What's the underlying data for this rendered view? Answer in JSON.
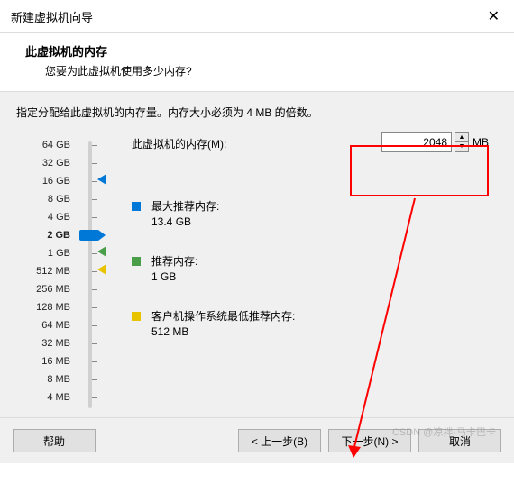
{
  "title": "新建虚拟机向导",
  "header": {
    "title": "此虚拟机的内存",
    "subtitle": "您要为此虚拟机使用多少内存?"
  },
  "instruction": "指定分配给此虚拟机的内存量。内存大小必须为 4 MB 的倍数。",
  "scale": [
    "64 GB",
    "32 GB",
    "16 GB",
    "8 GB",
    "4 GB",
    "2 GB",
    "1 GB",
    "512 MB",
    "256 MB",
    "128 MB",
    "64 MB",
    "32 MB",
    "16 MB",
    "8 MB",
    "4 MB"
  ],
  "bold_index": 5,
  "memory_label": "此虚拟机的内存(M):",
  "memory_value": "2048",
  "memory_unit": "MB",
  "legends": [
    {
      "color": "blue",
      "label": "最大推荐内存:",
      "value": "13.4 GB"
    },
    {
      "color": "green",
      "label": "推荐内存:",
      "value": "1 GB"
    },
    {
      "color": "yellow",
      "label": "客户机操作系统最低推荐内存:",
      "value": "512 MB"
    }
  ],
  "buttons": {
    "help": "帮助",
    "back": "< 上一步(B)",
    "next": "下一步(N) >",
    "cancel": "取消"
  },
  "watermark": "CSDN @凉拌·马卡巴卡"
}
